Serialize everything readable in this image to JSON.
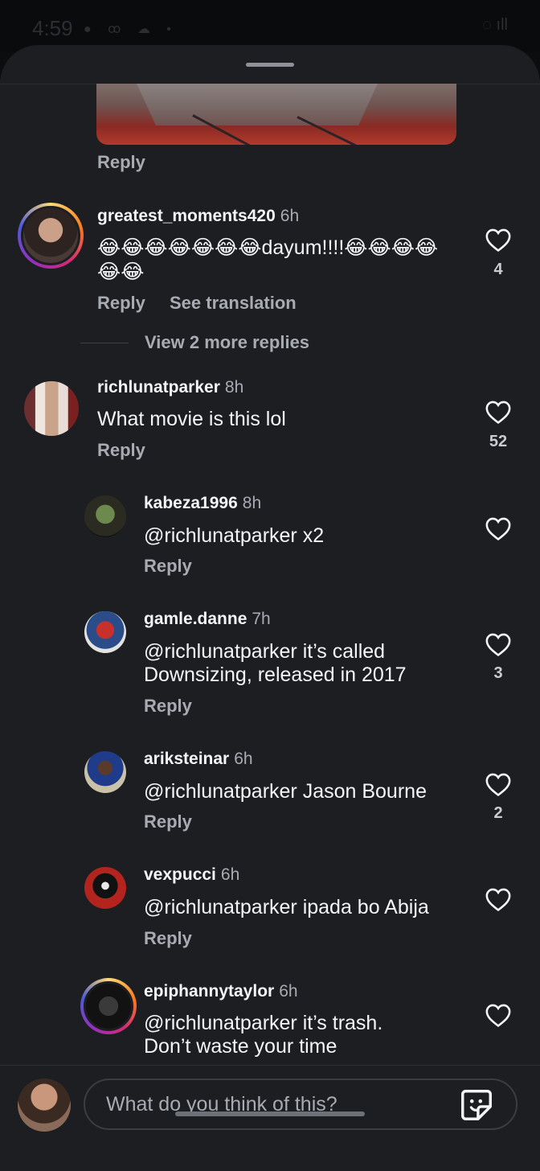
{
  "status_bar": {
    "time": "4:59",
    "left_icons": "● ꝏ ☁ •",
    "right_icons": "◌ ıll"
  },
  "thread": {
    "top_reply_label": "Reply",
    "view_more_replies": "View 2 more replies",
    "comments": [
      {
        "username": "greatest_moments420",
        "time": "6h",
        "text_line1": "😂😂😂😂😂😂😂dayum!!!!😂😂😂😂",
        "text_line2": "😂😂",
        "reply_label": "Reply",
        "see_translation": "See translation",
        "likes": "4"
      },
      {
        "username": "richlunatparker",
        "time": "8h",
        "text_line1": "What movie is this lol",
        "reply_label": "Reply",
        "likes": "52"
      }
    ],
    "replies": [
      {
        "username": "kabeza1996",
        "time": "8h",
        "mention": "richlunatparker",
        "text_line1": " x2",
        "reply_label": "Reply",
        "likes": ""
      },
      {
        "username": "gamle.danne",
        "time": "7h",
        "mention": "richlunatparker",
        "text_line1": "  it’s called",
        "text_line2": "Downsizing, released in 2017",
        "reply_label": "Reply",
        "likes": "3"
      },
      {
        "username": "ariksteinar",
        "time": "6h",
        "mention": "richlunatparker",
        "text_line1": " Jason Bourne",
        "reply_label": "Reply",
        "likes": "2"
      },
      {
        "username": "vexpucci",
        "time": "6h",
        "mention": "richlunatparker",
        "text_line1": " ipada bo Abija",
        "reply_label": "Reply",
        "likes": ""
      },
      {
        "username": "epiphannytaylor",
        "time": "6h",
        "mention": "richlunatparker",
        "text_line1": " it’s trash.",
        "text_line2": "Don’t waste your time",
        "reply_label": "",
        "likes": ""
      }
    ]
  },
  "composer": {
    "placeholder": "What do you think of this?"
  },
  "colors": {
    "sheet_bg": "#1c1e21",
    "text_primary": "#f3f5f7",
    "text_secondary": "#a8acb2"
  }
}
